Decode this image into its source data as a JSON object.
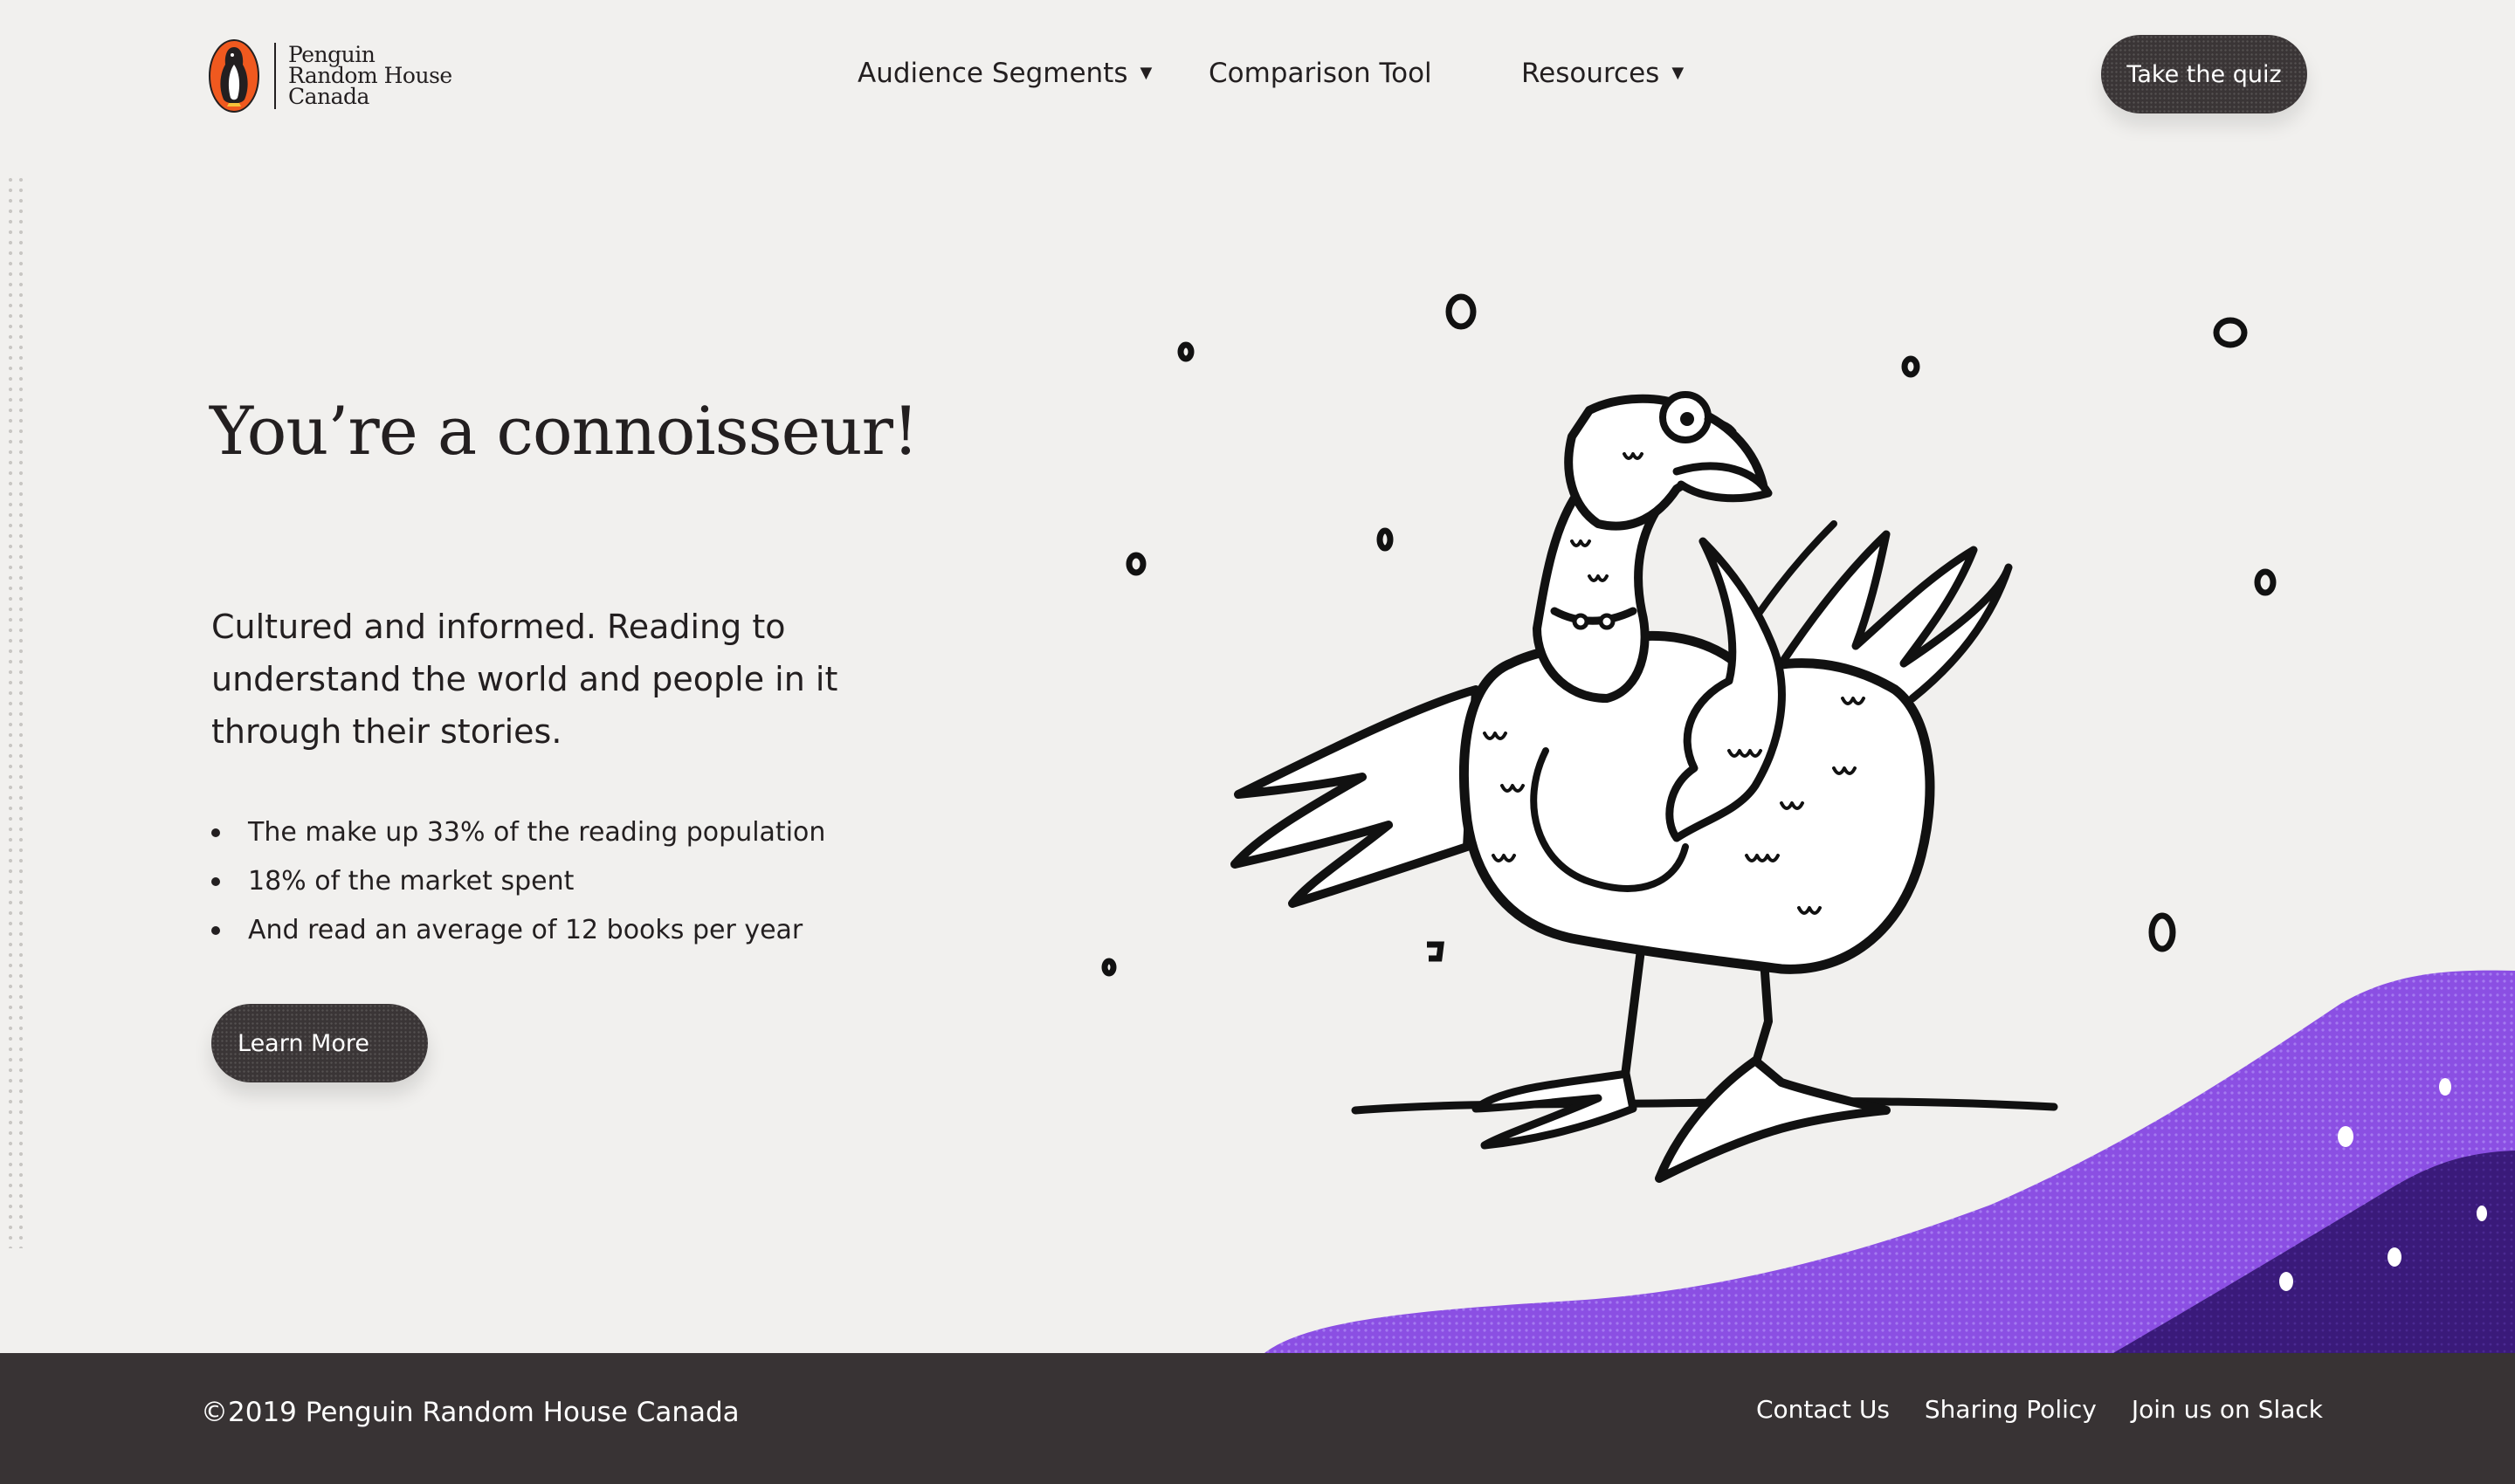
{
  "brand": {
    "line1": "Penguin",
    "line2": "Random House",
    "line3": "Canada",
    "logo_color": "#f0591f"
  },
  "nav": {
    "items": [
      {
        "label": "Audience Segments",
        "dropdown": true
      },
      {
        "label": "Comparison Tool",
        "dropdown": false
      },
      {
        "label": "Resources",
        "dropdown": true
      }
    ],
    "caret": "▼",
    "cta_label": "Take the quiz"
  },
  "hero": {
    "title": "You’re a connoisseur!",
    "description": "Cultured and informed. Reading to understand the world and people in it through their stories.",
    "stats": [
      "The make up 33% of the reading population",
      "18% of the market spent",
      "And read an average of 12 books per year"
    ],
    "button_label": "Learn More"
  },
  "illustration": {
    "subject": "bird-with-monocle",
    "accent_color": "#8b4fe3",
    "accent_dark": "#3a1a7a"
  },
  "footer": {
    "copyright": "©2019 Penguin Random House Canada",
    "links": [
      "Contact Us",
      "Sharing Policy",
      "Join us on Slack"
    ]
  }
}
